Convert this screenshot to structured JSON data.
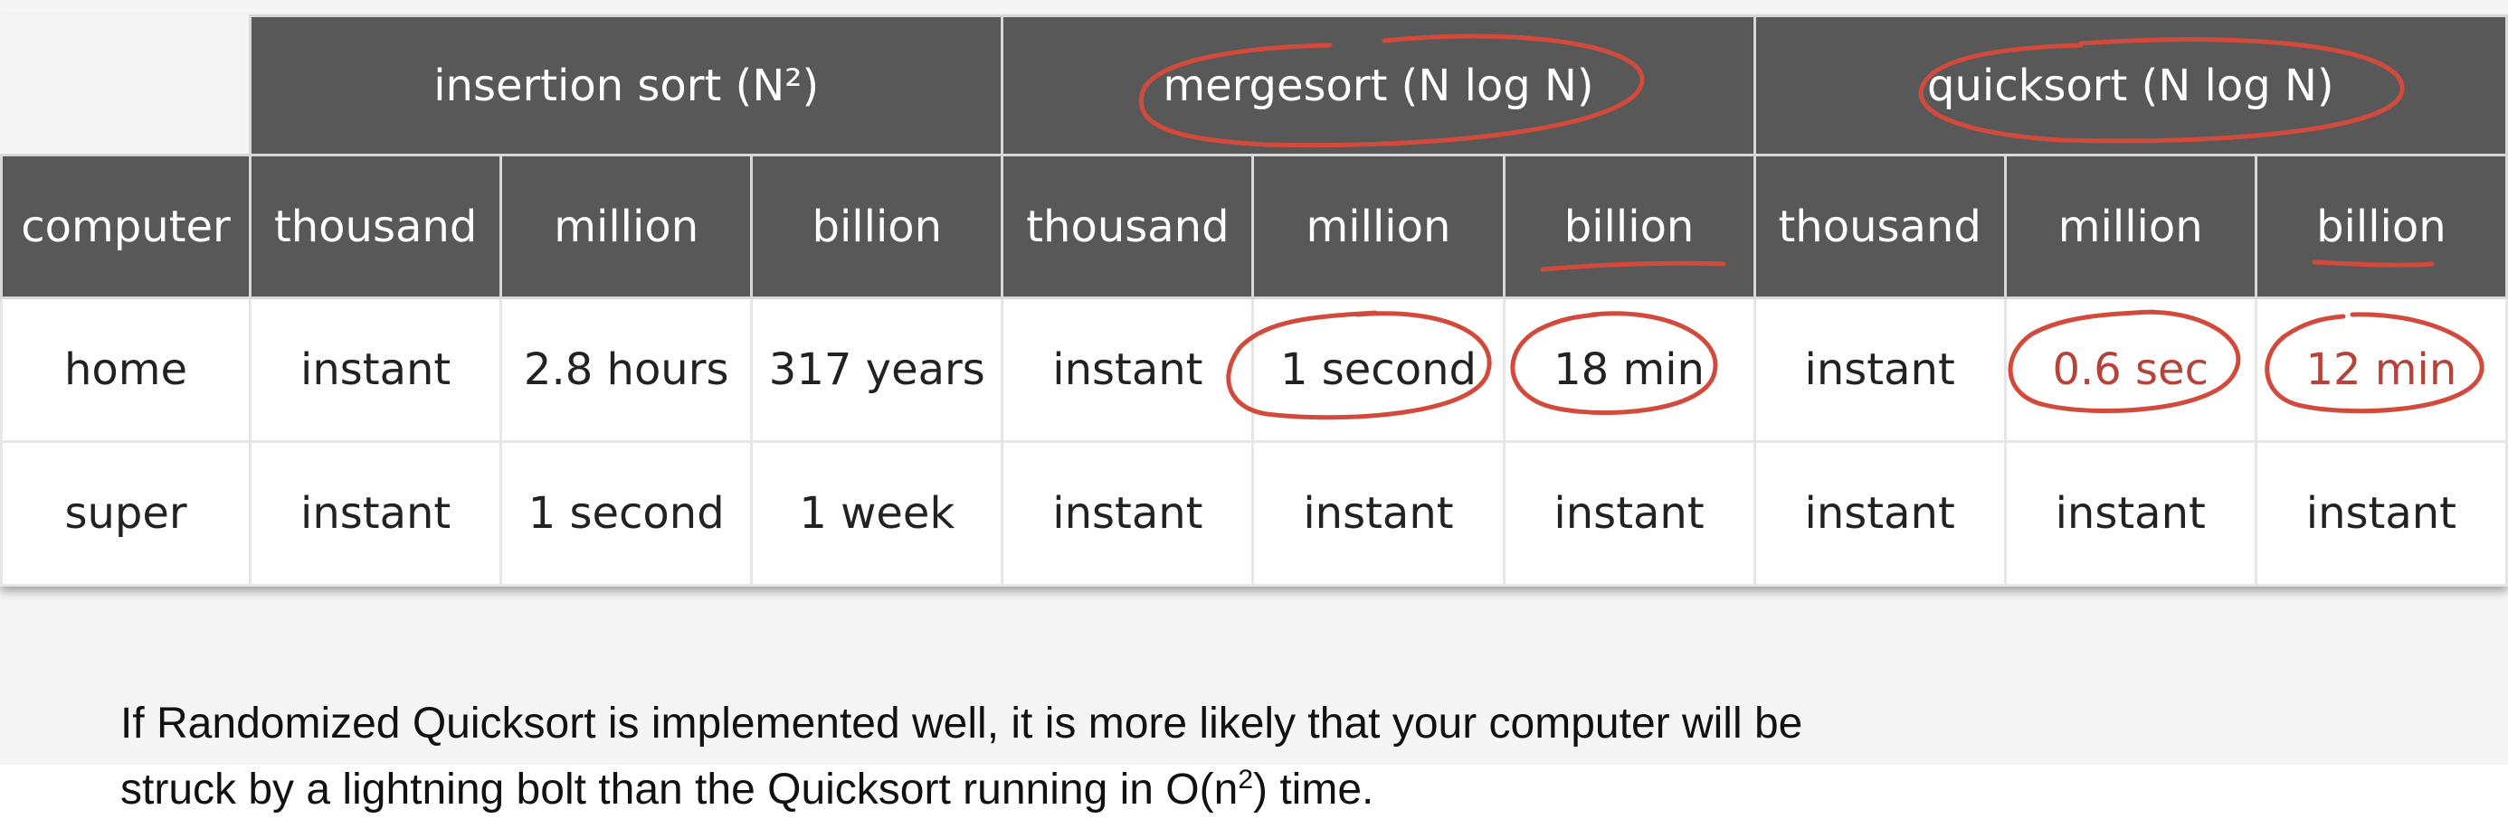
{
  "table": {
    "groups": [
      {
        "label": "insertion sort (N²)"
      },
      {
        "label": "mergesort (N log N)"
      },
      {
        "label": "quicksort (N log N)"
      }
    ],
    "corner_header": "computer",
    "sizes": [
      "thousand",
      "million",
      "billion",
      "thousand",
      "million",
      "billion",
      "thousand",
      "million",
      "billion"
    ],
    "rows": [
      {
        "computer": "home",
        "cells": [
          "instant",
          "2.8 hours",
          "317 years",
          "instant",
          "1 second",
          "18 min",
          "instant",
          "0.6 sec",
          "12 min"
        ]
      },
      {
        "computer": "super",
        "cells": [
          "instant",
          "1 second",
          "1 week",
          "instant",
          "instant",
          "instant",
          "instant",
          "instant",
          "instant"
        ]
      }
    ]
  },
  "caption": {
    "line1": "If Randomized Quicksort is implemented well, it is more likely that your computer will be",
    "line2_pre": "struck by a lightning bolt than the Quicksort running in O(n",
    "line2_sup": "2",
    "line2_post": ") time."
  },
  "colors": {
    "header_bg": "#585858",
    "annotation_red": "#d24a3c",
    "highlight_text": "#b5433a"
  }
}
